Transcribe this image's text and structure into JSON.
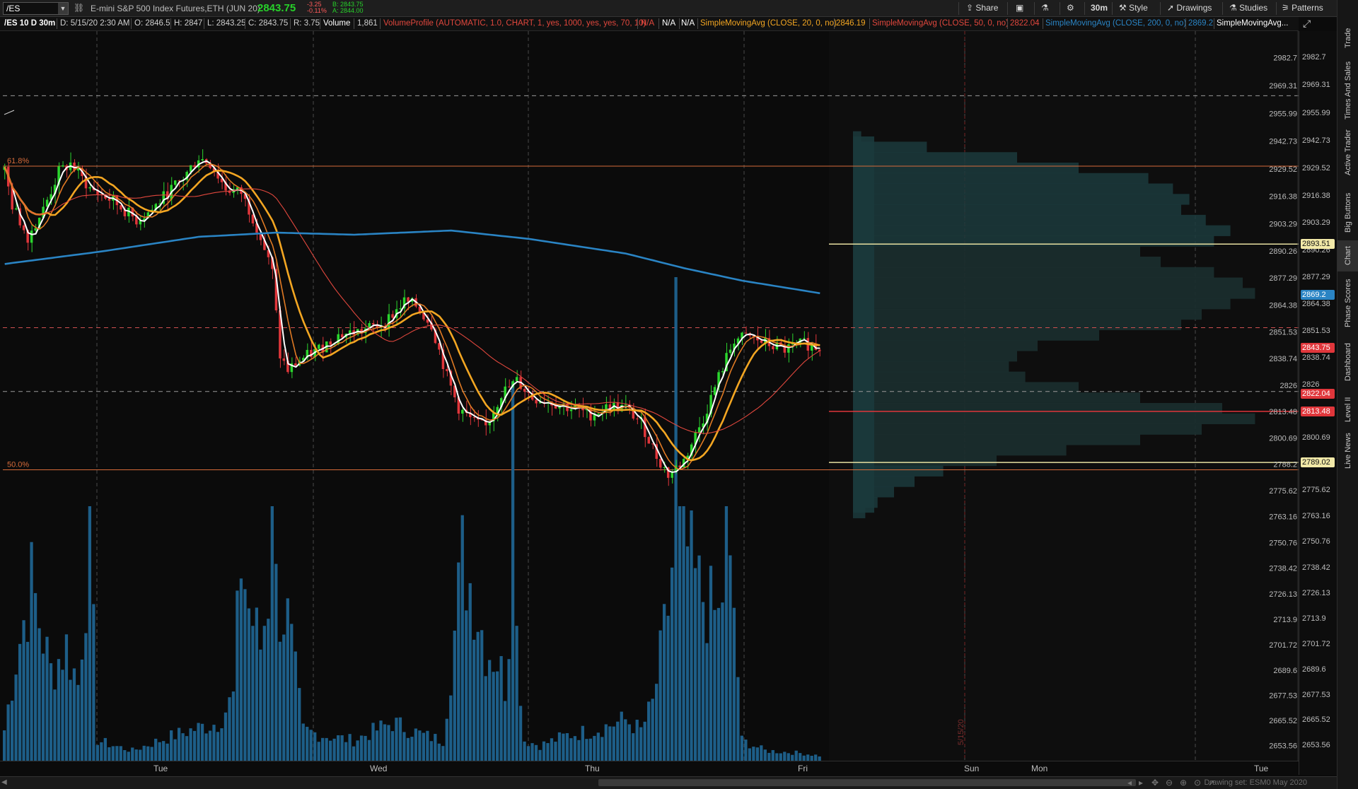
{
  "toolbar": {
    "symbol": "/ES",
    "description": "E-mini S&P 500 Index Futures,ETH (JUN 20)",
    "last_price": "2843.75",
    "net_change": "-3.25",
    "net_change_pct": "-0.11%",
    "bid": "B: 2843.75",
    "ask": "A: 2844.00",
    "buttons": {
      "share": "Share",
      "timeframe": "30m",
      "style": "Style",
      "drawings": "Drawings",
      "studies": "Studies",
      "patterns": "Patterns"
    }
  },
  "studybar": {
    "chart_title": "/ES 10 D 30m",
    "date": "D: 5/15/20 2:30 AM",
    "open": "O: 2846.5",
    "high": "H: 2847",
    "low": "L: 2843.25",
    "close": "C: 2843.75",
    "range": "R: 3.75",
    "volume_label": "Volume",
    "volume_value": "1,861",
    "vp_label": "VolumeProfile (AUTOMATIC, 1.0, CHART, 1, yes, 1000, yes, yes, 70, 10)",
    "na1": "N/A",
    "na2": "N/A",
    "na3": "N/A",
    "sma20_label": "SimpleMovingAvg (CLOSE, 20, 0, no)",
    "sma20_value": "2846.19",
    "sma50_label": "SimpleMovingAvg (CLOSE, 50, 0, no)",
    "sma50_value": "2822.04",
    "sma200_label": "SimpleMovingAvg (CLOSE, 200, 0, no)",
    "sma200_value": "2869.2",
    "sma_more_label": "SimpleMovingAvg..."
  },
  "colors": {
    "up": "#2bd62e",
    "down": "#e0363b",
    "volume": "#1d5e88",
    "sma200": "#2a84c4",
    "sma20": "#f3a622",
    "sma50": "#e0473d",
    "fast_white": "#ffffff",
    "orange": "#e07a24",
    "profile": "#1b3a3c",
    "fib": "#d66b3a"
  },
  "side_tabs": [
    "Trade",
    "Times And Sales",
    "Active Trader",
    "Big Buttons",
    "Chart",
    "Phase Scores",
    "Dashboard",
    "Level II",
    "Live News"
  ],
  "bottom": {
    "drawing_set": "Drawing set: ESM0 May 2020"
  },
  "chart_data": {
    "type": "candlestick",
    "ylim": [
      2647.0,
      2990.0
    ],
    "y_ticks": [
      "2982.7",
      "2969.31",
      "2955.99",
      "2942.73",
      "2929.52",
      "2916.38",
      "2903.29",
      "2890.26",
      "2877.29",
      "2864.38",
      "2851.53",
      "2838.74",
      "2826",
      "2813.48",
      "2800.69",
      "2788.2",
      "2775.62",
      "2763.16",
      "2750.76",
      "2738.42",
      "2726.13",
      "2713.9",
      "2701.72",
      "2689.6",
      "2677.53",
      "2665.52",
      "2653.56"
    ],
    "x_labels": [
      "Tue",
      "Wed",
      "Thu",
      "Fri",
      "Sun",
      "Mon",
      "Tue"
    ],
    "date_marker": "5/15/20",
    "fib_levels": [
      {
        "label": "61.8%",
        "price": 2930.8
      },
      {
        "label": "50.0%",
        "price": 2785.5
      }
    ],
    "price_tags": [
      {
        "value": "2893.51",
        "price": 2893.51,
        "bg": "#f2e9a8",
        "fg": "#111"
      },
      {
        "value": "2869.2",
        "price": 2869.2,
        "bg": "#2a84c4",
        "fg": "#fff"
      },
      {
        "value": "2843.75",
        "price": 2843.75,
        "bg": "#e0363b",
        "fg": "#fff"
      },
      {
        "value": "2822.04",
        "price": 2822.04,
        "bg": "#e0363b",
        "fg": "#fff"
      },
      {
        "value": "2813.48",
        "price": 2813.48,
        "bg": "#e0363b",
        "fg": "#fff"
      },
      {
        "value": "2789.02",
        "price": 2789.02,
        "bg": "#f2e9a8",
        "fg": "#111"
      }
    ],
    "dashed_levels": [
      {
        "price": 2964.5,
        "color": "#9a9a9a"
      },
      {
        "price": 2853.5,
        "color": "#d05050"
      },
      {
        "price": 2823.0,
        "color": "#9a9a9a"
      }
    ],
    "value_area": {
      "vah": 2893.51,
      "val": 2789.02,
      "poc": 2813.48
    },
    "price_anchors": [
      [
        0,
        2929
      ],
      [
        2,
        2912
      ],
      [
        6,
        2897
      ],
      [
        10,
        2910
      ],
      [
        14,
        2928
      ],
      [
        17,
        2932
      ],
      [
        22,
        2920
      ],
      [
        28,
        2914
      ],
      [
        34,
        2905
      ],
      [
        38,
        2910
      ],
      [
        42,
        2918
      ],
      [
        46,
        2925
      ],
      [
        50,
        2935
      ],
      [
        53,
        2932
      ],
      [
        57,
        2920
      ],
      [
        61,
        2918
      ],
      [
        65,
        2902
      ],
      [
        69,
        2880
      ],
      [
        71,
        2840
      ],
      [
        73,
        2833
      ],
      [
        76,
        2838
      ],
      [
        80,
        2842
      ],
      [
        86,
        2850
      ],
      [
        92,
        2852
      ],
      [
        98,
        2856
      ],
      [
        103,
        2866
      ],
      [
        106,
        2864
      ],
      [
        110,
        2855
      ],
      [
        114,
        2830
      ],
      [
        117,
        2815
      ],
      [
        121,
        2808
      ],
      [
        124,
        2806
      ],
      [
        128,
        2822
      ],
      [
        132,
        2828
      ],
      [
        136,
        2820
      ],
      [
        141,
        2818
      ],
      [
        146,
        2815
      ],
      [
        151,
        2812
      ],
      [
        156,
        2816
      ],
      [
        160,
        2815
      ],
      [
        164,
        2808
      ],
      [
        168,
        2792
      ],
      [
        171,
        2783
      ],
      [
        175,
        2790
      ],
      [
        180,
        2810
      ],
      [
        184,
        2830
      ],
      [
        188,
        2848
      ],
      [
        192,
        2849
      ],
      [
        196,
        2846
      ],
      [
        201,
        2843
      ],
      [
        206,
        2846
      ],
      [
        210,
        2844
      ]
    ],
    "volume_anchors": [
      [
        0,
        12
      ],
      [
        3,
        40
      ],
      [
        7,
        70
      ],
      [
        9,
        55
      ],
      [
        12,
        35
      ],
      [
        16,
        45
      ],
      [
        19,
        30
      ],
      [
        22,
        88
      ],
      [
        24,
        8
      ],
      [
        28,
        6
      ],
      [
        33,
        4
      ],
      [
        40,
        8
      ],
      [
        48,
        12
      ],
      [
        55,
        15
      ],
      [
        59,
        25
      ],
      [
        61,
        80
      ],
      [
        63,
        60
      ],
      [
        66,
        45
      ],
      [
        69,
        75
      ],
      [
        71,
        60
      ],
      [
        73,
        55
      ],
      [
        77,
        12
      ],
      [
        82,
        10
      ],
      [
        90,
        8
      ],
      [
        100,
        15
      ],
      [
        108,
        10
      ],
      [
        113,
        8
      ],
      [
        116,
        50
      ],
      [
        118,
        80
      ],
      [
        121,
        65
      ],
      [
        124,
        45
      ],
      [
        127,
        40
      ],
      [
        129,
        30
      ],
      [
        131,
        70
      ],
      [
        134,
        8
      ],
      [
        138,
        6
      ],
      [
        145,
        10
      ],
      [
        152,
        12
      ],
      [
        160,
        16
      ],
      [
        164,
        12
      ],
      [
        167,
        22
      ],
      [
        169,
        40
      ],
      [
        171,
        60
      ],
      [
        173,
        92
      ],
      [
        175,
        88
      ],
      [
        178,
        70
      ],
      [
        181,
        62
      ],
      [
        184,
        55
      ],
      [
        186,
        78
      ],
      [
        188,
        60
      ],
      [
        190,
        8
      ],
      [
        196,
        4
      ],
      [
        205,
        3
      ],
      [
        210,
        2
      ]
    ],
    "sma200_anchors": [
      [
        0,
        2884
      ],
      [
        25,
        2890
      ],
      [
        50,
        2897
      ],
      [
        70,
        2899
      ],
      [
        90,
        2898
      ],
      [
        115,
        2900
      ],
      [
        135,
        2896
      ],
      [
        160,
        2889
      ],
      [
        175,
        2882
      ],
      [
        190,
        2876
      ],
      [
        210,
        2870
      ]
    ],
    "profile_bins": [
      [
        2945,
        0.02
      ],
      [
        2940,
        0.18
      ],
      [
        2935,
        0.4
      ],
      [
        2930,
        0.55
      ],
      [
        2925,
        0.72
      ],
      [
        2920,
        0.78
      ],
      [
        2915,
        0.82
      ],
      [
        2910,
        0.8
      ],
      [
        2905,
        0.86
      ],
      [
        2900,
        0.92
      ],
      [
        2895,
        0.88
      ],
      [
        2890,
        0.7
      ],
      [
        2885,
        0.75
      ],
      [
        2880,
        0.88
      ],
      [
        2875,
        0.95
      ],
      [
        2870,
        0.98
      ],
      [
        2865,
        0.92
      ],
      [
        2860,
        0.85
      ],
      [
        2855,
        0.8
      ],
      [
        2850,
        0.6
      ],
      [
        2845,
        0.45
      ],
      [
        2840,
        0.4
      ],
      [
        2835,
        0.38
      ],
      [
        2830,
        0.42
      ],
      [
        2825,
        0.55
      ],
      [
        2820,
        0.7
      ],
      [
        2815,
        0.9
      ],
      [
        2810,
        0.98
      ],
      [
        2805,
        0.85
      ],
      [
        2800,
        0.7
      ],
      [
        2795,
        0.52
      ],
      [
        2790,
        0.35
      ],
      [
        2785,
        0.22
      ],
      [
        2780,
        0.15
      ],
      [
        2775,
        0.1
      ],
      [
        2770,
        0.06
      ],
      [
        2765,
        0.03
      ]
    ]
  }
}
